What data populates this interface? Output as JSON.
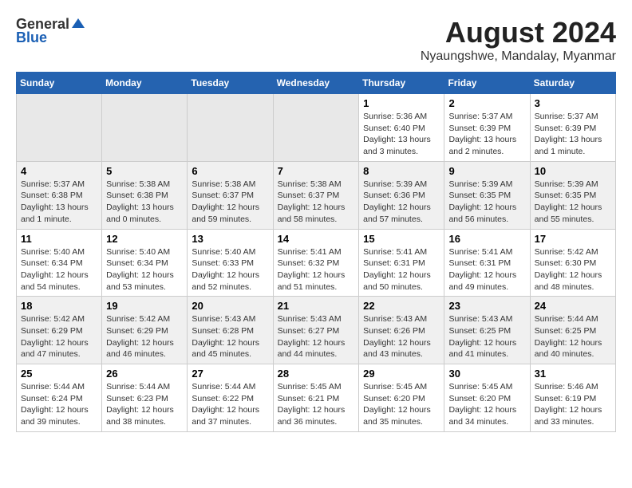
{
  "logo": {
    "general": "General",
    "blue": "Blue"
  },
  "title": "August 2024",
  "location": "Nyaungshwe, Mandalay, Myanmar",
  "weekdays": [
    "Sunday",
    "Monday",
    "Tuesday",
    "Wednesday",
    "Thursday",
    "Friday",
    "Saturday"
  ],
  "weeks": [
    [
      {
        "day": "",
        "info": ""
      },
      {
        "day": "",
        "info": ""
      },
      {
        "day": "",
        "info": ""
      },
      {
        "day": "",
        "info": ""
      },
      {
        "day": "1",
        "info": "Sunrise: 5:36 AM\nSunset: 6:40 PM\nDaylight: 13 hours\nand 3 minutes."
      },
      {
        "day": "2",
        "info": "Sunrise: 5:37 AM\nSunset: 6:39 PM\nDaylight: 13 hours\nand 2 minutes."
      },
      {
        "day": "3",
        "info": "Sunrise: 5:37 AM\nSunset: 6:39 PM\nDaylight: 13 hours\nand 1 minute."
      }
    ],
    [
      {
        "day": "4",
        "info": "Sunrise: 5:37 AM\nSunset: 6:38 PM\nDaylight: 13 hours\nand 1 minute."
      },
      {
        "day": "5",
        "info": "Sunrise: 5:38 AM\nSunset: 6:38 PM\nDaylight: 13 hours\nand 0 minutes."
      },
      {
        "day": "6",
        "info": "Sunrise: 5:38 AM\nSunset: 6:37 PM\nDaylight: 12 hours\nand 59 minutes."
      },
      {
        "day": "7",
        "info": "Sunrise: 5:38 AM\nSunset: 6:37 PM\nDaylight: 12 hours\nand 58 minutes."
      },
      {
        "day": "8",
        "info": "Sunrise: 5:39 AM\nSunset: 6:36 PM\nDaylight: 12 hours\nand 57 minutes."
      },
      {
        "day": "9",
        "info": "Sunrise: 5:39 AM\nSunset: 6:35 PM\nDaylight: 12 hours\nand 56 minutes."
      },
      {
        "day": "10",
        "info": "Sunrise: 5:39 AM\nSunset: 6:35 PM\nDaylight: 12 hours\nand 55 minutes."
      }
    ],
    [
      {
        "day": "11",
        "info": "Sunrise: 5:40 AM\nSunset: 6:34 PM\nDaylight: 12 hours\nand 54 minutes."
      },
      {
        "day": "12",
        "info": "Sunrise: 5:40 AM\nSunset: 6:34 PM\nDaylight: 12 hours\nand 53 minutes."
      },
      {
        "day": "13",
        "info": "Sunrise: 5:40 AM\nSunset: 6:33 PM\nDaylight: 12 hours\nand 52 minutes."
      },
      {
        "day": "14",
        "info": "Sunrise: 5:41 AM\nSunset: 6:32 PM\nDaylight: 12 hours\nand 51 minutes."
      },
      {
        "day": "15",
        "info": "Sunrise: 5:41 AM\nSunset: 6:31 PM\nDaylight: 12 hours\nand 50 minutes."
      },
      {
        "day": "16",
        "info": "Sunrise: 5:41 AM\nSunset: 6:31 PM\nDaylight: 12 hours\nand 49 minutes."
      },
      {
        "day": "17",
        "info": "Sunrise: 5:42 AM\nSunset: 6:30 PM\nDaylight: 12 hours\nand 48 minutes."
      }
    ],
    [
      {
        "day": "18",
        "info": "Sunrise: 5:42 AM\nSunset: 6:29 PM\nDaylight: 12 hours\nand 47 minutes."
      },
      {
        "day": "19",
        "info": "Sunrise: 5:42 AM\nSunset: 6:29 PM\nDaylight: 12 hours\nand 46 minutes."
      },
      {
        "day": "20",
        "info": "Sunrise: 5:43 AM\nSunset: 6:28 PM\nDaylight: 12 hours\nand 45 minutes."
      },
      {
        "day": "21",
        "info": "Sunrise: 5:43 AM\nSunset: 6:27 PM\nDaylight: 12 hours\nand 44 minutes."
      },
      {
        "day": "22",
        "info": "Sunrise: 5:43 AM\nSunset: 6:26 PM\nDaylight: 12 hours\nand 43 minutes."
      },
      {
        "day": "23",
        "info": "Sunrise: 5:43 AM\nSunset: 6:25 PM\nDaylight: 12 hours\nand 41 minutes."
      },
      {
        "day": "24",
        "info": "Sunrise: 5:44 AM\nSunset: 6:25 PM\nDaylight: 12 hours\nand 40 minutes."
      }
    ],
    [
      {
        "day": "25",
        "info": "Sunrise: 5:44 AM\nSunset: 6:24 PM\nDaylight: 12 hours\nand 39 minutes."
      },
      {
        "day": "26",
        "info": "Sunrise: 5:44 AM\nSunset: 6:23 PM\nDaylight: 12 hours\nand 38 minutes."
      },
      {
        "day": "27",
        "info": "Sunrise: 5:44 AM\nSunset: 6:22 PM\nDaylight: 12 hours\nand 37 minutes."
      },
      {
        "day": "28",
        "info": "Sunrise: 5:45 AM\nSunset: 6:21 PM\nDaylight: 12 hours\nand 36 minutes."
      },
      {
        "day": "29",
        "info": "Sunrise: 5:45 AM\nSunset: 6:20 PM\nDaylight: 12 hours\nand 35 minutes."
      },
      {
        "day": "30",
        "info": "Sunrise: 5:45 AM\nSunset: 6:20 PM\nDaylight: 12 hours\nand 34 minutes."
      },
      {
        "day": "31",
        "info": "Sunrise: 5:46 AM\nSunset: 6:19 PM\nDaylight: 12 hours\nand 33 minutes."
      }
    ]
  ]
}
